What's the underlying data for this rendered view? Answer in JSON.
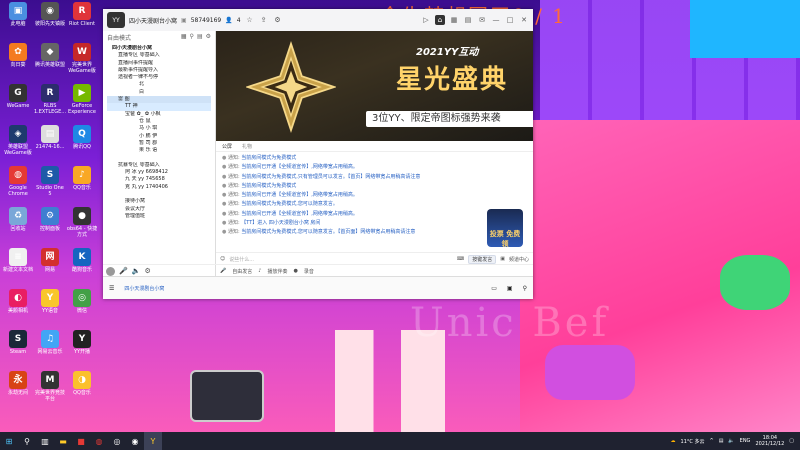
{
  "overlay_title": "今生梦想国干0 / 1",
  "watermark": "Unic  Bef",
  "desktop_icons": [
    {
      "label": "此电脑",
      "color": "#4a8fe0",
      "glyph": "▣"
    },
    {
      "label": "彼阳先天镇版",
      "color": "#555",
      "glyph": "◉"
    },
    {
      "label": "Riot Client",
      "color": "#e0343a",
      "glyph": "R"
    },
    {
      "label": "向日葵",
      "color": "#f47b20",
      "glyph": "✿"
    },
    {
      "label": "腾讯英雄联盟",
      "color": "#666",
      "glyph": "◆"
    },
    {
      "label": "完美世界 WeGame版",
      "color": "#c62828",
      "glyph": "W"
    },
    {
      "label": "WeGame",
      "color": "#333",
      "glyph": "G"
    },
    {
      "label": "RLBS 1.EXTLEGE...",
      "color": "#2d2d6e",
      "glyph": "R"
    },
    {
      "label": "GeForce Experience",
      "color": "#76b900",
      "glyph": "▶"
    },
    {
      "label": "英雄联盟WeGame版",
      "color": "#1e3a6e",
      "glyph": "◈"
    },
    {
      "label": "21474-16...",
      "color": "#ddd",
      "glyph": "▤"
    },
    {
      "label": "腾讯QQ",
      "color": "#1e88e5",
      "glyph": "Q"
    },
    {
      "label": "Google Chrome",
      "color": "#e53935",
      "glyph": "◍"
    },
    {
      "label": "Studio One 5",
      "color": "#1e5aa8",
      "glyph": "S"
    },
    {
      "label": "QQ音乐",
      "color": "#f9a825",
      "glyph": "♪"
    },
    {
      "label": "回收站",
      "color": "#7aa7d8",
      "glyph": "♻"
    },
    {
      "label": "控制面板",
      "color": "#3f7ed1",
      "glyph": "⚙"
    },
    {
      "label": "obs64 - 快捷方式",
      "color": "#333",
      "glyph": "●"
    },
    {
      "label": "新建文本文档",
      "color": "#f0f0f0",
      "glyph": "≡"
    },
    {
      "label": "网易",
      "color": "#d32f2f",
      "glyph": "网"
    },
    {
      "label": "酷狗音乐",
      "color": "#1565c0",
      "glyph": "K"
    },
    {
      "label": "美颜相机",
      "color": "#e91e63",
      "glyph": "◐"
    },
    {
      "label": "YY语音",
      "color": "#f9c62b",
      "glyph": "Y"
    },
    {
      "label": "微信",
      "color": "#43a047",
      "glyph": "◎"
    },
    {
      "label": "Steam",
      "color": "#1b2838",
      "glyph": "S"
    },
    {
      "label": "网易云音乐",
      "color": "#42a5f5",
      "glyph": "♫"
    },
    {
      "label": "YY开播",
      "color": "#222",
      "glyph": "Y"
    },
    {
      "label": "永劫无间",
      "color": "#d84315",
      "glyph": "永"
    },
    {
      "label": "完美世界竞技平台",
      "color": "#333",
      "glyph": "M"
    },
    {
      "label": "QQ音乐",
      "color": "#fbc02d",
      "glyph": "◑"
    }
  ],
  "yy": {
    "channel_name": "四小天漫剧台小窝",
    "channel_id": "58749169",
    "online": "4",
    "left_tools": [
      "自由模式"
    ],
    "tree_head": {
      "left": "四小天漫剧台小窝",
      "right": ""
    },
    "tree": [
      {
        "text": "四小天漫剧台小窝",
        "ind": 1,
        "bold": true
      },
      {
        "text": "直播专区  零基础入",
        "ind": 2
      },
      {
        "text": "直播间事件提醒",
        "ind": 2
      },
      {
        "text": "最新事件提醒导入",
        "ind": 2
      },
      {
        "text": "透视者一律不与停",
        "ind": 2
      },
      {
        "text": "北",
        "ind": 4
      },
      {
        "text": "白",
        "ind": 4
      },
      {
        "text": "雷    图",
        "ind": 2,
        "sel": true
      },
      {
        "text": "TT    神",
        "ind": 3,
        "hl": true
      },
      {
        "text": "宝爸  ✿_  ✿ 小枫",
        "ind": 3
      },
      {
        "text": "仓    鼠",
        "ind": 4
      },
      {
        "text": "马    小  琪",
        "ind": 4
      },
      {
        "text": "小    鹏  伊",
        "ind": 4
      },
      {
        "text": "暂    司  郡",
        "ind": 4
      },
      {
        "text": "果    乐  语",
        "ind": 4
      },
      {
        "text": "",
        "ind": 1
      },
      {
        "text": "抗暴专区  零基础入",
        "ind": 2
      },
      {
        "text": "阿    冰     yy  6698412",
        "ind": 3
      },
      {
        "text": "九    天     yy  745658",
        "ind": 3
      },
      {
        "text": "克    丸     yy  1740406",
        "ind": 3
      },
      {
        "text": "",
        "ind": 1
      },
      {
        "text": "接待小窝",
        "ind": 3
      },
      {
        "text": "会议大厅",
        "ind": 3
      },
      {
        "text": "管理值班",
        "ind": 3
      }
    ],
    "banner": {
      "brand": "2021YY互动",
      "title": "星光盛典",
      "subtitle": "3位YY、限定帝图标强势来袭"
    },
    "tabs": [
      "公屏",
      "礼物"
    ],
    "messages": [
      {
        "tag": "通知:",
        "text": "当前房间模式为免费模式"
      },
      {
        "tag": "通知:",
        "text": "当前房间已开通【全频道宣传】,网络带宽占用稍高。"
      },
      {
        "tag": "通知:",
        "text": "当前房间模式为免费模式,只有管理员可以发言。【首页】网络带宽占用稍高请注意"
      },
      {
        "tag": "通知:",
        "text": "当前房间模式为免费模式"
      },
      {
        "tag": "通知:",
        "text": "当前房间已开通【全频道宣传】,网络带宽占用稍高。"
      },
      {
        "tag": "通知:",
        "text": "当前房间模式为免费模式,您可以随意发言。"
      },
      {
        "tag": "通知:",
        "text": "当前房间已开通【全频道宣传】,网络带宽占用稍高。"
      },
      {
        "tag": "通知:",
        "text": "【TT】进入 四小天漫剧台小窝 房间"
      },
      {
        "tag": "通知:",
        "text": "当前房间模式为免费模式,您可以随意发言。【首页面】网络带宽占用稍高请注意"
      }
    ],
    "gift_label": "投票 免费领",
    "input_placeholder": "说些什么...",
    "input_right": "频道中心",
    "speak_btn": "按键发言",
    "bottom_tools": [
      "自由发言",
      "播放伴奏",
      "录音"
    ],
    "foot_channel": "四小天漫剧台小窝"
  },
  "taskbar": {
    "weather": "11°C 多云",
    "lang": "ENG",
    "time": "18:04",
    "date": "2021/12/12"
  }
}
